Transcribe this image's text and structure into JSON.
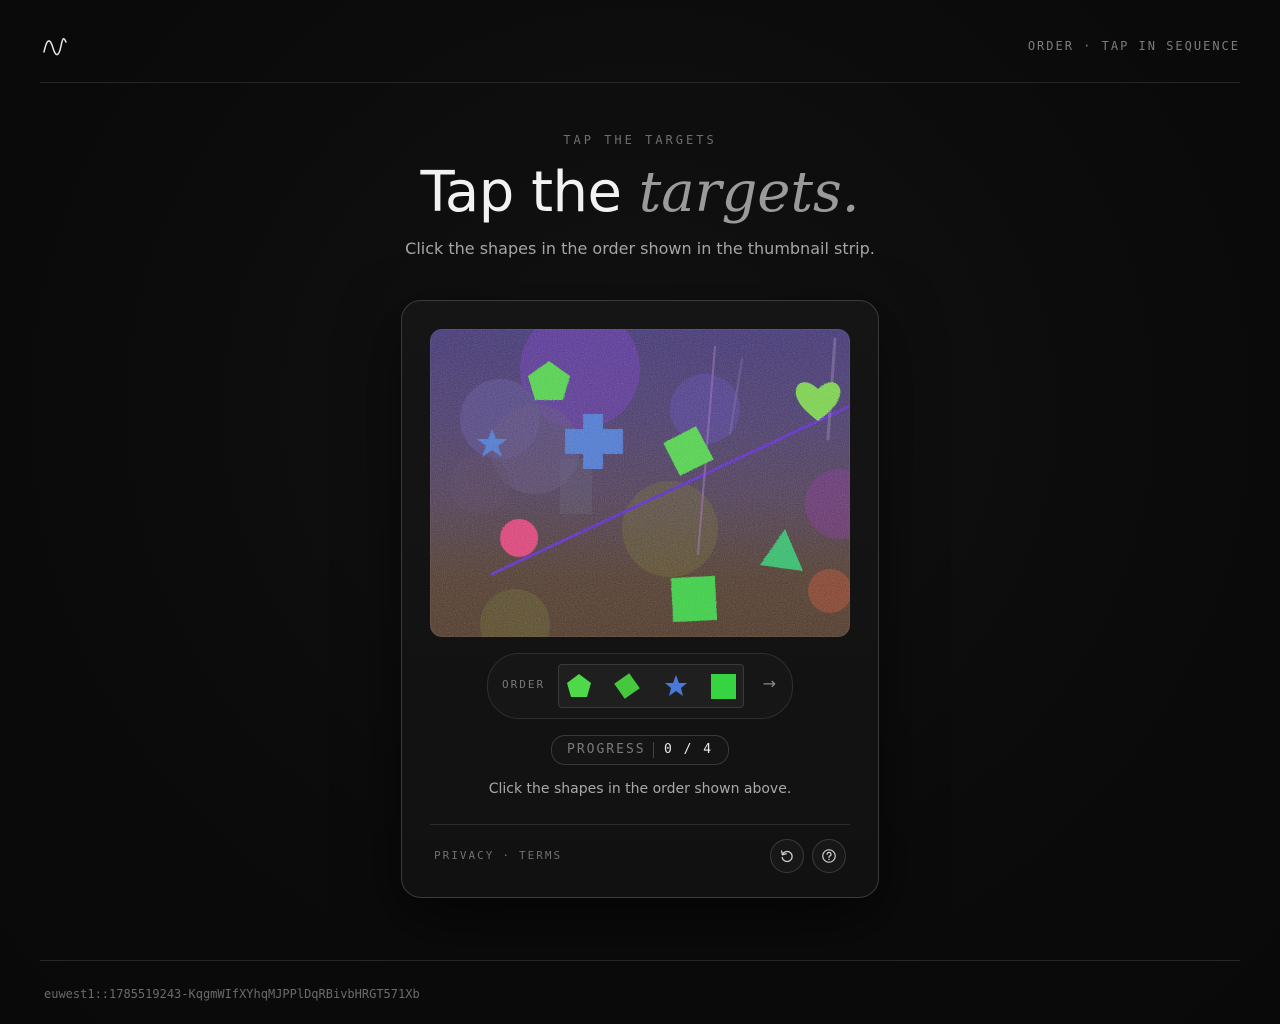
{
  "header": {
    "logo_icon": "wave-logo-icon",
    "meta_text": "ORDER · TAP IN SEQUENCE"
  },
  "hero": {
    "eyebrow": "TAP THE TARGETS",
    "title_main": "Tap the ",
    "title_accent": "targets.",
    "subtitle": "Click the shapes in the order shown in the thumbnail strip."
  },
  "challenge": {
    "order_label": "ORDER",
    "order_next_icon": "→",
    "order_sequence": [
      "pentagon",
      "diamond",
      "star",
      "square"
    ],
    "progress_label": "PROGRESS",
    "progress_value": "0 / 4",
    "progress_done": 0,
    "progress_total": 4,
    "instruction": "Click the shapes in the order shown above.",
    "colors": {
      "target_green": "#4fd84a",
      "decoy_blue": "#4a78d6",
      "decoy_pink": "#e23e77",
      "teal_green": "#2fc06a"
    }
  },
  "footer": {
    "privacy_label": "PRIVACY",
    "terms_label": "TERMS",
    "separator": "·",
    "reload_icon": "reload-icon",
    "help_icon": "help-icon"
  },
  "session": {
    "id": "euwest1::1785519243-KqgmWIfXYhqMJPPlDqRBivbHRGT571Xb"
  }
}
